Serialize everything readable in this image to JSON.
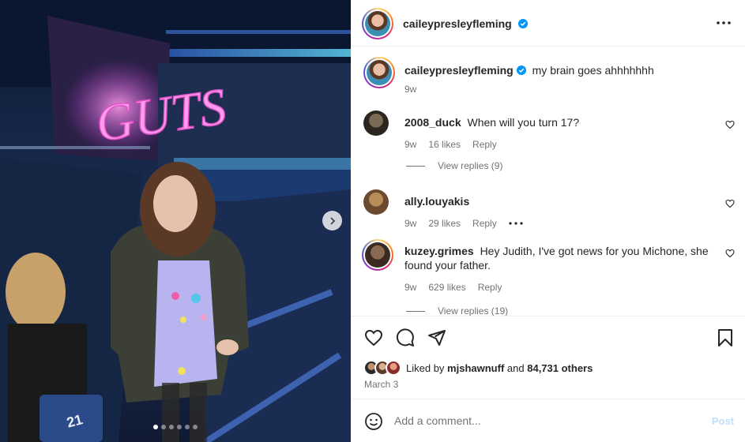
{
  "post": {
    "author": "caileypresleyfleming",
    "caption_user": "caileypresleyfleming",
    "caption_text": "my brain goes ahhhhhhh",
    "caption_time": "9w",
    "photo_sign_text": "GUTS",
    "photo_seat_number": "21",
    "carousel": {
      "dots": 6,
      "active_index": 0
    }
  },
  "comments": [
    {
      "user": "2008_duck",
      "text": "When will you turn 17?",
      "time": "9w",
      "likes": "16 likes",
      "reply_label": "Reply",
      "view_replies": "View replies (9)"
    },
    {
      "user": "ally.louyakis",
      "text": "",
      "time": "9w",
      "likes": "29 likes",
      "reply_label": "Reply",
      "view_replies": ""
    },
    {
      "user": "kuzey.grimes",
      "text": "Hey Judith, I've got news for you Michone, she found your father.",
      "time": "9w",
      "likes": "629 likes",
      "reply_label": "Reply",
      "view_replies": "View replies (19)"
    }
  ],
  "likes": {
    "prefix": "Liked by",
    "user": "mjshawnuff",
    "middle": "and",
    "count": "84,731 others"
  },
  "date": "March 3",
  "composer": {
    "placeholder": "Add a comment...",
    "post_label": "Post"
  },
  "colors": {
    "verified": "#0095f6",
    "post_disabled": "#c0dffd",
    "muted_text": "#737373"
  },
  "icons": [
    "verified-icon",
    "more-icon",
    "heart-icon",
    "comment-icon",
    "share-icon",
    "bookmark-icon",
    "emoji-icon",
    "chevron-right-icon"
  ]
}
